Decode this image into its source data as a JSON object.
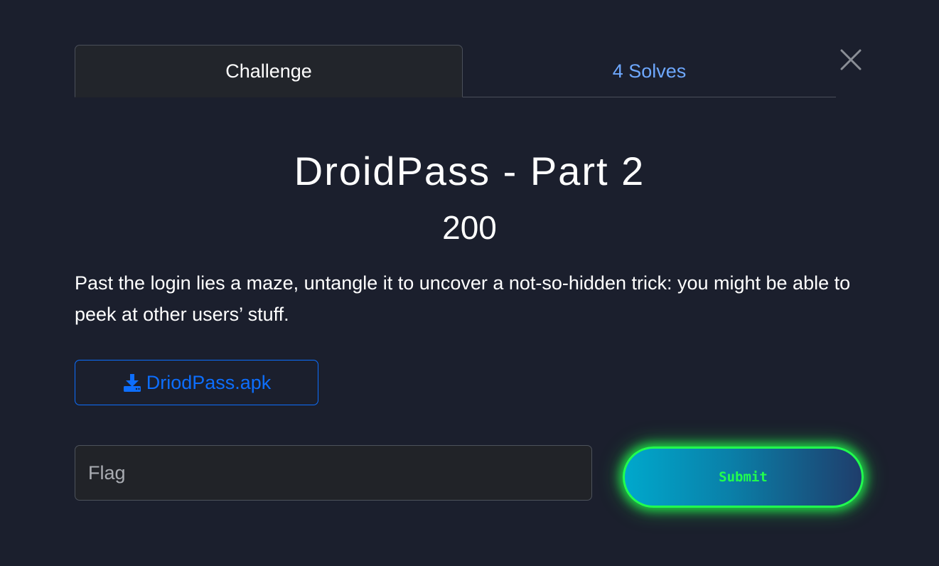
{
  "tabs": [
    {
      "label": "Challenge",
      "active": true
    },
    {
      "label": "4 Solves",
      "active": false
    }
  ],
  "challenge": {
    "name": "DroidPass - Part 2",
    "points": "200",
    "description": "Past the login lies a maze, untangle it to uncover a not-so-hidden trick: you might be able to peek at other users’ stuff."
  },
  "file": {
    "label": "DriodPass.apk",
    "icon": "download-icon"
  },
  "flag_input": {
    "placeholder": "Flag",
    "value": ""
  },
  "submit": {
    "label": "Submit"
  },
  "colors": {
    "background": "#1b1f2d",
    "link": "#6ea8fe",
    "primary": "#0d6efd",
    "neon_green": "#21ff4e"
  }
}
